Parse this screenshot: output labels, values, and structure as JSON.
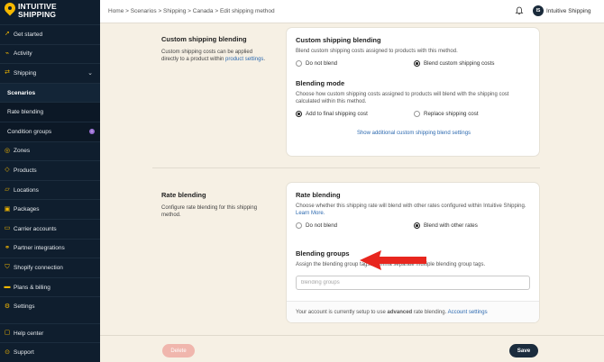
{
  "brand": {
    "line1": "INTUITIVE",
    "line2": "SHIPPING"
  },
  "breadcrumb": "Home > Scenarios > Shipping > Canada > Edit shipping method",
  "user": {
    "initials": "IS",
    "name": "Intuitive Shipping"
  },
  "sidebar": {
    "items": [
      {
        "label": "Get started",
        "icon": "rocket-icon"
      },
      {
        "label": "Activity",
        "icon": "activity-icon"
      },
      {
        "label": "Shipping",
        "icon": "shipping-icon",
        "expanded": true
      },
      {
        "label": "Scenarios",
        "sub": true,
        "active": true
      },
      {
        "label": "Rate blending",
        "sub": true
      },
      {
        "label": "Condition groups",
        "sub": true,
        "badge": "i"
      },
      {
        "label": "Zones",
        "icon": "globe-icon"
      },
      {
        "label": "Products",
        "icon": "tag-icon"
      },
      {
        "label": "Locations",
        "icon": "location-icon"
      },
      {
        "label": "Packages",
        "icon": "package-icon"
      },
      {
        "label": "Carrier accounts",
        "icon": "truck-icon"
      },
      {
        "label": "Partner integrations",
        "icon": "integration-icon"
      },
      {
        "label": "Shopify connection",
        "icon": "shopify-icon"
      },
      {
        "label": "Plans & billing",
        "icon": "credit-card-icon"
      },
      {
        "label": "Settings",
        "icon": "gear-icon"
      }
    ],
    "bottom": [
      {
        "label": "Help center",
        "icon": "help-icon"
      },
      {
        "label": "Support",
        "icon": "support-icon"
      }
    ]
  },
  "custom_blending": {
    "section_title": "Custom shipping blending",
    "section_desc": "Custom shipping costs can be applied directly to a product within ",
    "section_link": "product settings",
    "section_desc_end": ".",
    "card_title": "Custom shipping blending",
    "card_desc": "Blend custom shipping costs assigned to products with this method.",
    "option_no": "Do not blend",
    "option_yes": "Blend custom shipping costs",
    "mode_title": "Blending mode",
    "mode_desc": "Choose how custom shipping costs assigned to products will blend with the shipping cost calculated within this method.",
    "mode_add": "Add to final shipping cost",
    "mode_replace": "Replace shipping cost",
    "show_more": "Show additional custom shipping blend settings"
  },
  "rate_blending": {
    "section_title": "Rate blending",
    "section_desc": "Configure rate blending for this shipping method.",
    "card_title": "Rate blending",
    "card_desc": "Choose whether this shipping rate will blend with other rates configured within Intuitive Shipping. ",
    "learn_more": "Learn More.",
    "option_no": "Do not blend",
    "option_yes": "Blend with other rates",
    "groups_title": "Blending groups",
    "groups_desc": "Assign the blending group tags. Comma separate multiple blending group tags.",
    "groups_placeholder": "blending groups",
    "footer_text": "Your account is currently setup to use ",
    "footer_bold": "advanced",
    "footer_text2": " rate blending. ",
    "footer_link": "Account settings"
  },
  "actions": {
    "delete": "Delete",
    "save": "Save"
  },
  "colors": {
    "sidebar": "#0f1e2e",
    "accent": "#f5b800",
    "background": "#f6f0e4",
    "arrow": "#e8261e",
    "link": "#2d6ab0"
  }
}
